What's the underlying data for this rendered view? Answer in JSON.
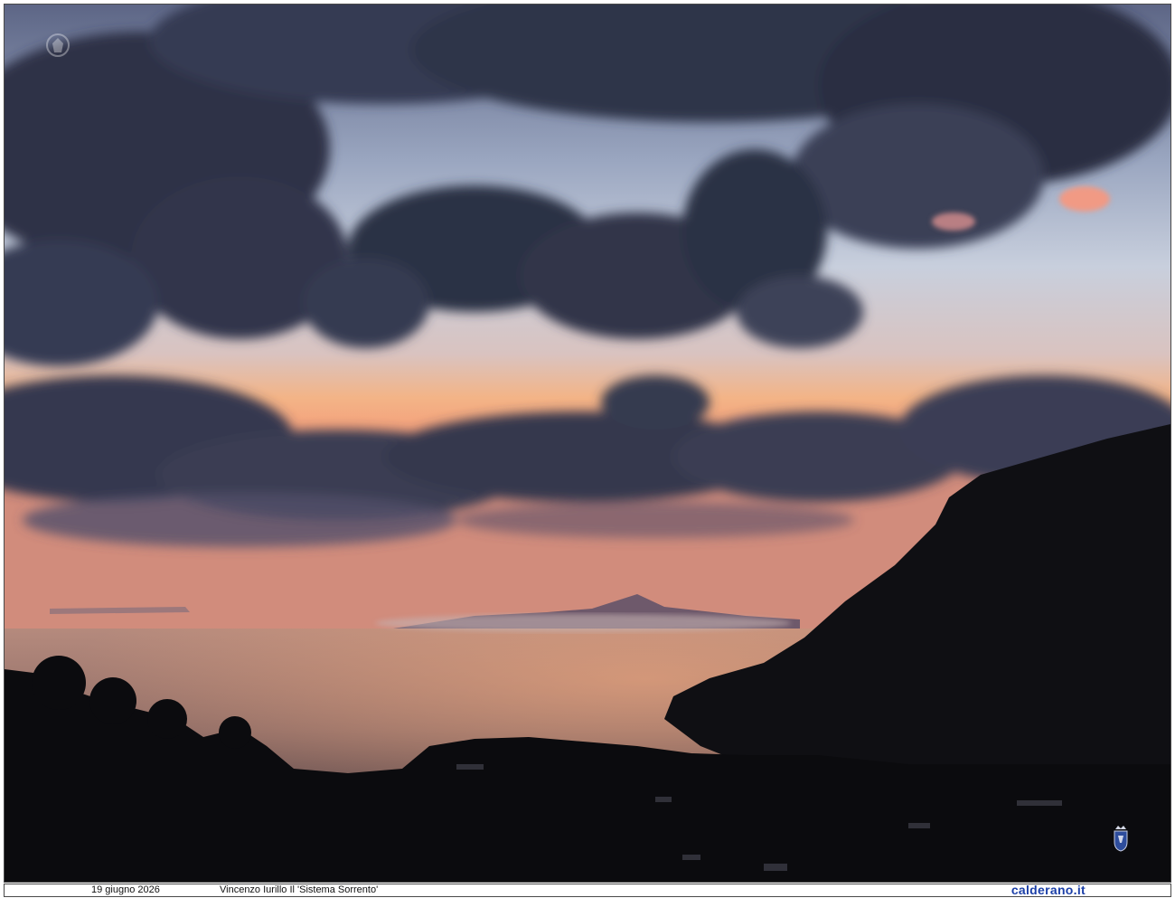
{
  "caption": {
    "date": "19 giugno 2026",
    "author_title": "Vincenzo Iurillo Il 'Sistema Sorrento'",
    "site": "calderano.it"
  },
  "colors": {
    "sky_top": "#8d9bb7",
    "sky_mid": "#c7cfdf",
    "horizon_glow": "#f3a27a",
    "clouds": "#2f3348",
    "sea": "#8c7067",
    "silhouette": "#0d0d10",
    "site_link": "#1b3fa8"
  },
  "icons": {
    "emblem": "coat-of-arms-icon",
    "watermark": "crest-watermark-icon"
  }
}
